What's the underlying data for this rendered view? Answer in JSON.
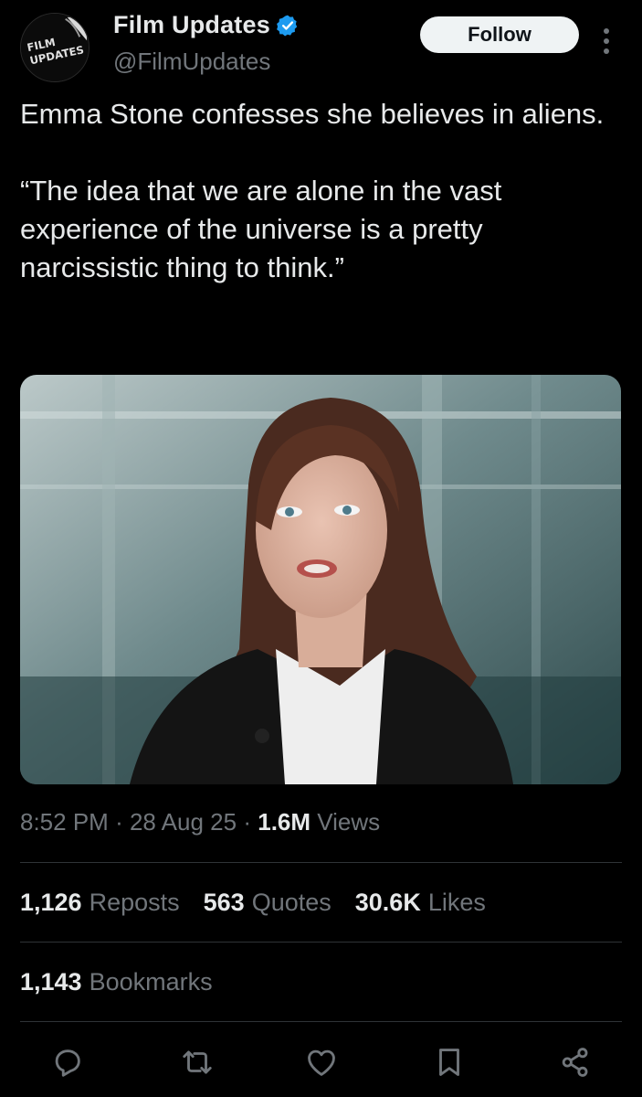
{
  "account": {
    "avatar_text_line1": "FILM",
    "avatar_text_line2": "UPDATES",
    "display_name": "Film Updates",
    "handle": "@FilmUpdates",
    "verified_color": "#1d9bf0"
  },
  "follow_button": {
    "label": "Follow"
  },
  "tweet": {
    "text": "Emma Stone confesses she believes in aliens.\n\n“The idea that we are alone in the vast experience of the universe is a pretty narcissistic thing to think.”"
  },
  "meta": {
    "time": "8:52 PM",
    "separator": "·",
    "date": "28 Aug 25",
    "views_count": "1.6M",
    "views_label": "Views"
  },
  "stats": {
    "reposts_count": "1,126",
    "reposts_label": "Reposts",
    "quotes_count": "563",
    "quotes_label": "Quotes",
    "likes_count": "30.6K",
    "likes_label": "Likes",
    "bookmarks_count": "1,143",
    "bookmarks_label": "Bookmarks"
  },
  "action_bar": {
    "icons": [
      "reply-icon",
      "repost-icon",
      "like-icon",
      "bookmark-icon",
      "share-icon"
    ]
  },
  "colors": {
    "background": "#000000",
    "text_primary": "#e7e9ea",
    "text_secondary": "#71767b",
    "divider": "#2f3336"
  }
}
